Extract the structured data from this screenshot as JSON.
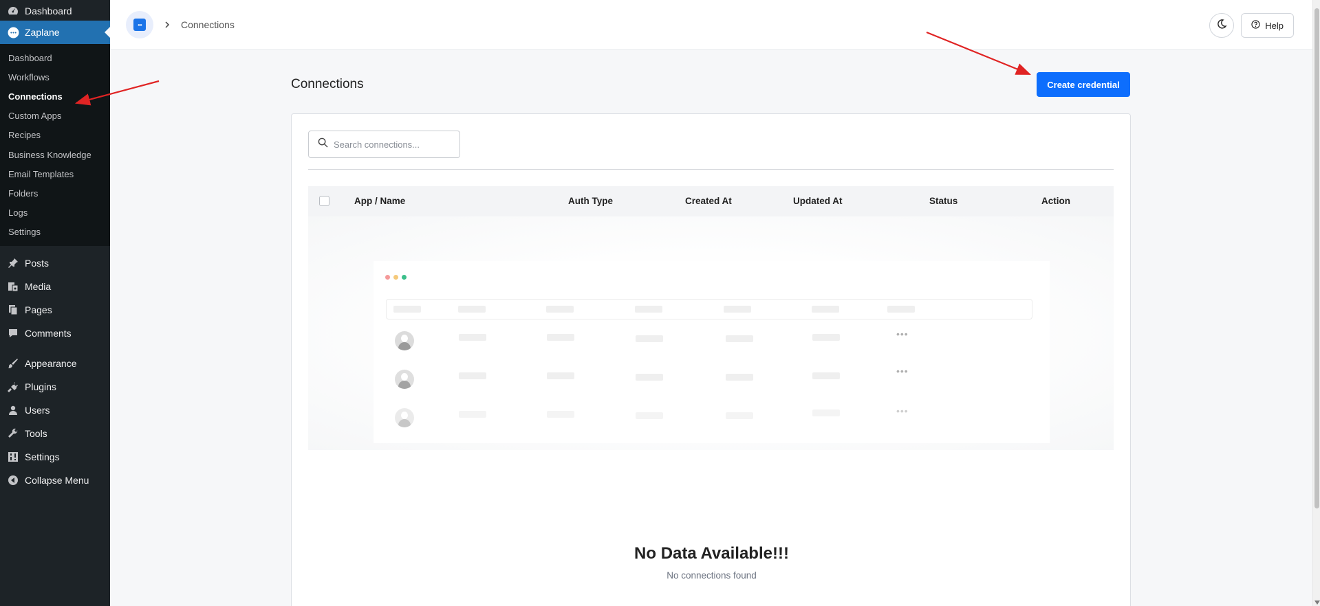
{
  "sidebar": {
    "top_items": [
      {
        "label": "Dashboard",
        "icon": "dashboard-icon"
      },
      {
        "label": "Zaplane",
        "icon": "zaplane-icon"
      }
    ],
    "submenu": [
      "Dashboard",
      "Workflows",
      "Connections",
      "Custom Apps",
      "Recipes",
      "Business Knowledge",
      "Email Templates",
      "Folders",
      "Logs",
      "Settings"
    ],
    "main_items": [
      {
        "label": "Posts",
        "icon": "pin-icon"
      },
      {
        "label": "Media",
        "icon": "media-icon"
      },
      {
        "label": "Pages",
        "icon": "pages-icon"
      },
      {
        "label": "Comments",
        "icon": "comments-icon"
      }
    ],
    "main_items2": [
      {
        "label": "Appearance",
        "icon": "paintbrush-icon"
      },
      {
        "label": "Plugins",
        "icon": "plugin-icon"
      },
      {
        "label": "Users",
        "icon": "user-icon"
      },
      {
        "label": "Tools",
        "icon": "wrench-icon"
      },
      {
        "label": "Settings",
        "icon": "settings-icon"
      },
      {
        "label": "Collapse Menu",
        "icon": "collapse-icon"
      }
    ]
  },
  "header": {
    "breadcrumb": "Connections",
    "help_label": "Help"
  },
  "main": {
    "title": "Connections",
    "create_button": "Create credential",
    "search_placeholder": "Search connections...",
    "columns": [
      "App / Name",
      "Auth Type",
      "Created At",
      "Updated At",
      "Status",
      "Action"
    ],
    "empty_title": "No Data Available!!!",
    "empty_subtitle": "No connections found"
  },
  "colors": {
    "accent": "#0d6efd",
    "sidebar_bg": "#1d2327",
    "active_menu": "#2271b1",
    "annotation_arrow": "#e02424"
  }
}
